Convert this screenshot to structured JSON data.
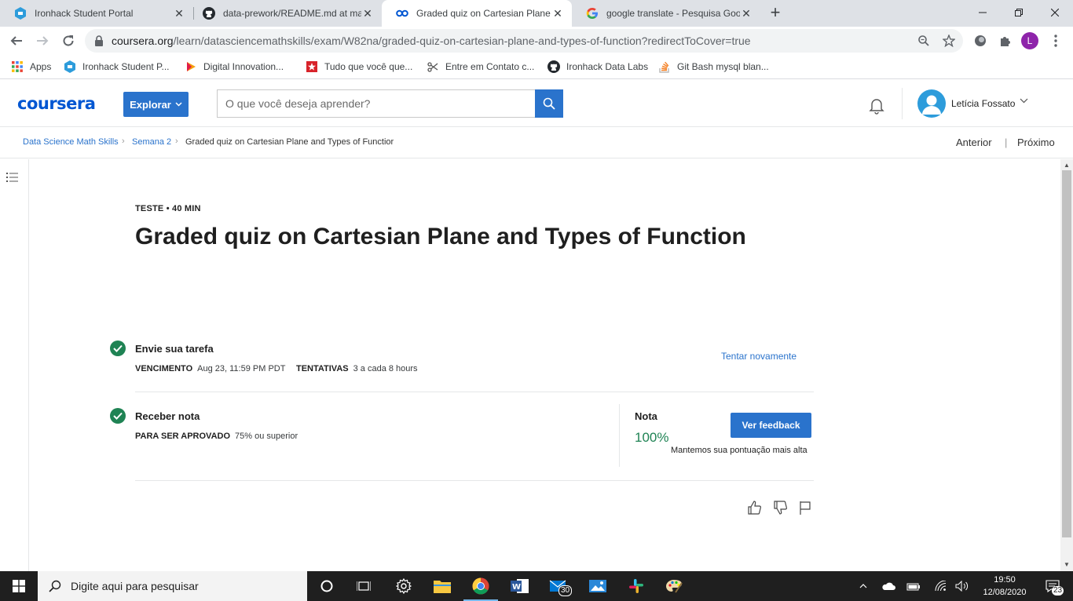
{
  "browser": {
    "tabs": [
      {
        "title": "Ironhack Student Portal",
        "icon": "ironhack-icon"
      },
      {
        "title": "data-prework/README.md at ma",
        "icon": "github-icon"
      },
      {
        "title": "Graded quiz on Cartesian Plane a",
        "icon": "coursera-icon",
        "active": true
      },
      {
        "title": "google translate - Pesquisa Goog",
        "icon": "google-icon"
      }
    ],
    "url_host": "coursera.org",
    "url_path": "/learn/datasciencemathskills/exam/W82na/graded-quiz-on-cartesian-plane-and-types-of-function?redirectToCover=true",
    "profile_initial": "L",
    "bookmarks": [
      {
        "label": "Apps",
        "icon": "apps-grid-icon"
      },
      {
        "label": "Ironhack Student P...",
        "icon": "ironhack-icon"
      },
      {
        "label": "Digital Innovation...",
        "icon": "dio-icon"
      },
      {
        "label": "Tudo que você que...",
        "icon": "star-badge-icon"
      },
      {
        "label": "Entre em Contato c...",
        "icon": "scissors-icon"
      },
      {
        "label": "Ironhack Data Labs",
        "icon": "github-icon"
      },
      {
        "label": "Git Bash mysql blan...",
        "icon": "stackoverflow-icon"
      }
    ]
  },
  "header": {
    "logo": "coursera",
    "explore_label": "Explorar",
    "search_placeholder": "O que você deseja aprender?",
    "user_name": "Letícia Fossato"
  },
  "breadcrumb": {
    "items": [
      "Data Science Math Skills",
      "Semana 2",
      "Graded quiz on Cartesian Plane and Types of Functior"
    ],
    "prev": "Anterior",
    "next": "Próximo"
  },
  "quiz": {
    "eyebrow": "TESTE • 40 MIN",
    "title": "Graded quiz on Cartesian Plane and Types of Function",
    "submit": {
      "title": "Envie sua tarefa",
      "due_label": "VENCIMENTO",
      "due_value": "Aug 23, 11:59 PM PDT",
      "attempts_label": "TENTATIVAS",
      "attempts_value": "3 a cada 8 hours",
      "retry_label": "Tentar novamente"
    },
    "grade": {
      "title": "Receber nota",
      "pass_label": "PARA SER APROVADO",
      "pass_value": "75% ou superior",
      "grade_label": "Nota",
      "grade_value": "100%",
      "feedback_button": "Ver feedback",
      "note": "Mantemos sua pontuação mais alta"
    }
  },
  "taskbar": {
    "search_placeholder": "Digite aqui para pesquisar",
    "mail_badge": "30",
    "time": "19:50",
    "date": "12/08/2020",
    "notification_count": "23"
  },
  "colors": {
    "coursera_blue": "#0056d2",
    "button_blue": "#2a73cc",
    "success_green": "#1f8354"
  }
}
